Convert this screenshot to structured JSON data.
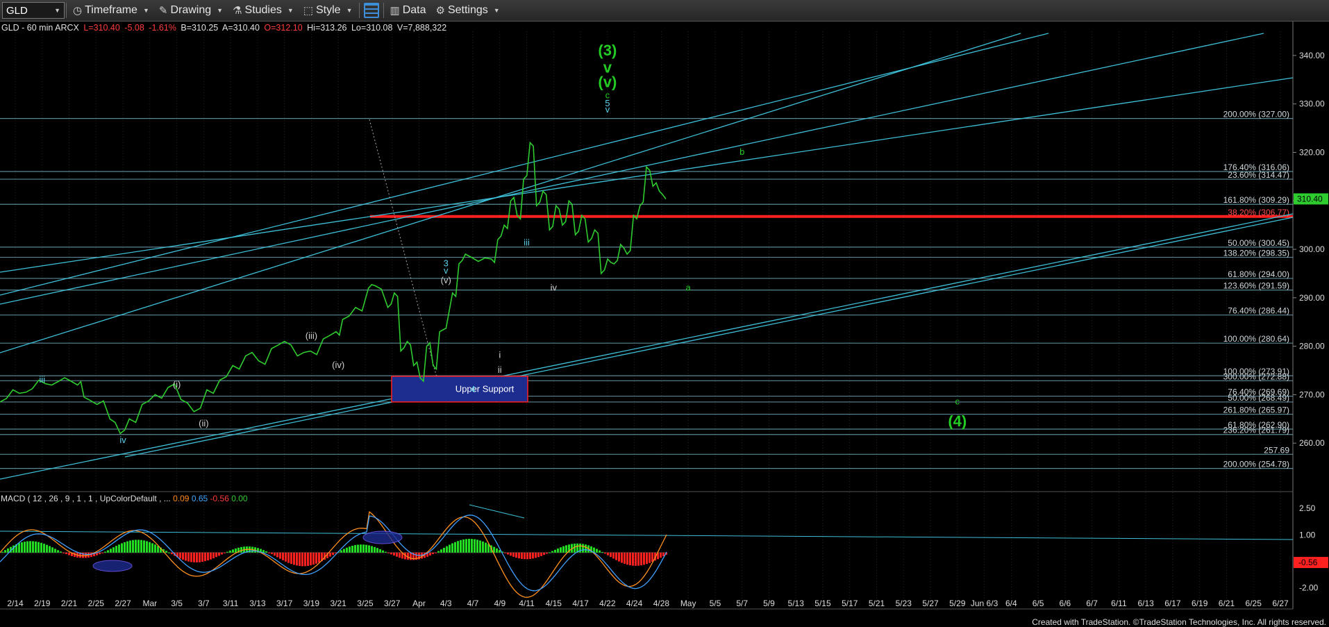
{
  "toolbar": {
    "symbol": "GLD",
    "timeframe": "Timeframe",
    "drawing": "Drawing",
    "studies": "Studies",
    "style": "Style",
    "data": "Data",
    "settings": "Settings"
  },
  "symbol_info": {
    "name": "GLD - 60 min  ARCX",
    "last": "L=310.40",
    "change": "-5.08",
    "change_pct": "-1.61%",
    "bid": "B=310.25",
    "ask": "A=310.40",
    "open": "O=312.10",
    "high": "Hi=313.26",
    "low": "Lo=310.08",
    "volume": "V=7,888,322"
  },
  "macd_label": {
    "name": "MACD ( 12 , 26 , 9 , 1 , 1 , UpColorDefault , ...",
    "v1": "0.09",
    "v2": "0.65",
    "v3": "-0.56",
    "v4": "0.00"
  },
  "footer": "Created with TradeStation. ©TradeStation Technologies, Inc. All rights reserved.",
  "colors": {
    "price": "#2ecc2e",
    "fib_line": "#7ab4c7",
    "support_line": "#ff2020",
    "trend_line": "#3ec0d8",
    "wave_green": "#22cc22",
    "macd_line": "#ff9020",
    "signal_line": "#40a0ff"
  },
  "chart_data": {
    "type": "line",
    "title": "GLD - 60 min",
    "price_axis": {
      "min": 250,
      "max": 345,
      "ticks": [
        260,
        270,
        280,
        290,
        300,
        310,
        320,
        330,
        340
      ]
    },
    "last_price": "310.40",
    "date_ticks": [
      "2/14",
      "2/19",
      "2/21",
      "2/25",
      "2/27",
      "Mar",
      "3/5",
      "3/7",
      "3/11",
      "3/13",
      "3/17",
      "3/19",
      "3/21",
      "3/25",
      "3/27",
      "Apr",
      "4/3",
      "4/7",
      "4/9",
      "4/11",
      "4/15",
      "4/17",
      "4/22",
      "4/24",
      "4/28",
      "May",
      "5/5",
      "5/7",
      "5/9",
      "5/13",
      "5/15",
      "5/17",
      "5/21",
      "5/23",
      "5/27",
      "5/29",
      "Jun 6/3",
      "6/4",
      "6/5",
      "6/6",
      "6/7",
      "6/11",
      "6/13",
      "6/17",
      "6/19",
      "6/21",
      "6/25",
      "6/27"
    ],
    "price_series": [
      [
        0,
        268.5
      ],
      [
        0.01,
        271
      ],
      [
        0.02,
        270.5
      ],
      [
        0.03,
        273
      ],
      [
        0.04,
        272
      ],
      [
        0.05,
        273.5
      ],
      [
        0.06,
        272
      ],
      [
        0.065,
        269.5
      ],
      [
        0.075,
        268
      ],
      [
        0.085,
        265
      ],
      [
        0.093,
        262
      ],
      [
        0.1,
        265
      ],
      [
        0.11,
        268
      ],
      [
        0.12,
        270
      ],
      [
        0.13,
        271.5
      ],
      [
        0.14,
        269
      ],
      [
        0.15,
        266.5
      ],
      [
        0.16,
        271
      ],
      [
        0.17,
        273
      ],
      [
        0.18,
        276
      ],
      [
        0.19,
        278
      ],
      [
        0.2,
        277
      ],
      [
        0.21,
        279.5
      ],
      [
        0.22,
        281
      ],
      [
        0.23,
        278
      ],
      [
        0.24,
        279
      ],
      [
        0.25,
        281.5
      ],
      [
        0.26,
        283
      ],
      [
        0.265,
        285.5
      ],
      [
        0.275,
        288
      ],
      [
        0.285,
        292
      ],
      [
        0.29,
        292.5
      ],
      [
        0.3,
        288
      ],
      [
        0.305,
        291
      ],
      [
        0.31,
        279
      ],
      [
        0.315,
        281
      ],
      [
        0.32,
        276
      ],
      [
        0.325,
        273.5
      ],
      [
        0.33,
        280
      ],
      [
        0.335,
        276
      ],
      [
        0.34,
        283
      ],
      [
        0.35,
        291
      ],
      [
        0.355,
        297
      ],
      [
        0.36,
        299
      ],
      [
        0.37,
        297.5
      ],
      [
        0.38,
        298
      ],
      [
        0.385,
        302
      ],
      [
        0.39,
        305
      ],
      [
        0.395,
        310
      ],
      [
        0.4,
        307
      ],
      [
        0.405,
        314.5
      ],
      [
        0.41,
        322
      ],
      [
        0.415,
        309
      ],
      [
        0.42,
        312
      ],
      [
        0.425,
        304
      ],
      [
        0.43,
        309
      ],
      [
        0.435,
        305
      ],
      [
        0.44,
        310
      ],
      [
        0.445,
        303
      ],
      [
        0.45,
        307
      ],
      [
        0.455,
        301.5
      ],
      [
        0.46,
        304
      ],
      [
        0.465,
        295
      ],
      [
        0.47,
        298
      ],
      [
        0.475,
        297
      ],
      [
        0.48,
        301
      ],
      [
        0.485,
        299
      ],
      [
        0.49,
        307
      ],
      [
        0.495,
        309
      ],
      [
        0.5,
        317
      ],
      [
        0.505,
        313
      ],
      [
        0.51,
        312
      ],
      [
        0.515,
        310.4
      ]
    ],
    "horizontal_levels": [
      {
        "label": "200.00% (327.00)",
        "value": 327.0
      },
      {
        "label": "176.40% (316.06)",
        "value": 316.06
      },
      {
        "label": "23.60% (314.47)",
        "value": 314.47
      },
      {
        "label": "161.80% (309.29)",
        "value": 309.29
      },
      {
        "label": "38.20% (306.77)",
        "value": 306.77
      },
      {
        "label": "50.00% (300.45)",
        "value": 300.45
      },
      {
        "label": "138.20% (298.35)",
        "value": 298.35
      },
      {
        "label": "61.80% (294.00)",
        "value": 294.0
      },
      {
        "label": "123.60% (291.59)",
        "value": 291.59
      },
      {
        "label": "76.40% (286.44)",
        "value": 286.44
      },
      {
        "label": "100.00% (280.64)",
        "value": 280.64
      },
      {
        "label": "100.00% (273.91)",
        "value": 273.91
      },
      {
        "label": "300.00% (272.88)",
        "value": 272.88
      },
      {
        "label": "76.40% (269.69)",
        "value": 269.69
      },
      {
        "label": "50.00% (268.49)",
        "value": 268.49
      },
      {
        "label": "261.80% (265.97)",
        "value": 265.97
      },
      {
        "label": "61.80% (262.90)",
        "value": 262.9
      },
      {
        "label": "236.20% (261.79)",
        "value": 261.79
      },
      {
        "label": "257.69",
        "value": 257.69
      },
      {
        "label": "200.00% (254.78)",
        "value": 254.78
      }
    ],
    "support_zone": {
      "label": "Upper Support",
      "low": 268.5,
      "high": 273.8
    },
    "wave_labels": [
      {
        "text": "(3)",
        "date_index": 22,
        "price": 340,
        "color": "green",
        "big": true
      },
      {
        "text": "v",
        "date_index": 22,
        "price": 336.5,
        "color": "green",
        "big": true
      },
      {
        "text": "(v)",
        "date_index": 22,
        "price": 333.5,
        "color": "green",
        "big": true
      },
      {
        "text": "c",
        "date_index": 22,
        "price": 331.2,
        "color": "green",
        "big": false
      },
      {
        "text": "5",
        "date_index": 22,
        "price": 329.5,
        "color": "cyan",
        "big": false
      },
      {
        "text": "v",
        "date_index": 22,
        "price": 328.2,
        "color": "cyan",
        "big": false
      },
      {
        "text": "b",
        "date_index": 27,
        "price": 319.5,
        "color": "green",
        "big": false
      },
      {
        "text": "a",
        "date_index": 25,
        "price": 291.5,
        "color": "green",
        "big": false
      },
      {
        "text": "3",
        "date_index": 16,
        "price": 296.5,
        "color": "cyan",
        "big": false
      },
      {
        "text": "v",
        "date_index": 16,
        "price": 295,
        "color": "cyan",
        "big": false
      },
      {
        "text": "(v)",
        "date_index": 16,
        "price": 293,
        "color": "white",
        "big": false
      },
      {
        "text": "iii",
        "date_index": 19,
        "price": 300.8,
        "color": "cyan",
        "big": false
      },
      {
        "text": "iv",
        "date_index": 20,
        "price": 291.5,
        "color": "white",
        "big": false
      },
      {
        "text": "i",
        "date_index": 18,
        "price": 277.6,
        "color": "white",
        "big": false
      },
      {
        "text": "ii",
        "date_index": 18,
        "price": 274.5,
        "color": "white",
        "big": false
      },
      {
        "text": "4",
        "date_index": 17,
        "price": 270.5,
        "color": "cyan",
        "big": false
      },
      {
        "text": "(iii)",
        "date_index": 11,
        "price": 281.5,
        "color": "white",
        "big": false
      },
      {
        "text": "(iv)",
        "date_index": 12,
        "price": 275.5,
        "color": "white",
        "big": false
      },
      {
        "text": "(i)",
        "date_index": 6,
        "price": 271.5,
        "color": "white",
        "big": false
      },
      {
        "text": "(ii)",
        "date_index": 7,
        "price": 263.5,
        "color": "white",
        "big": false
      },
      {
        "text": "iii",
        "date_index": 1,
        "price": 272.5,
        "color": "cyan",
        "big": false
      },
      {
        "text": "iv",
        "date_index": 4,
        "price": 260,
        "color": "cyan",
        "big": false
      },
      {
        "text": "c",
        "date_index": 35,
        "price": 268,
        "color": "green",
        "big": false
      },
      {
        "text": "(4)",
        "date_index": 35,
        "price": 263.5,
        "color": "green",
        "big": true
      }
    ],
    "macd_axis": {
      "ticks": [
        "2.50",
        "1.00",
        "-0.50",
        "-2.00"
      ],
      "current": "-0.56"
    }
  }
}
